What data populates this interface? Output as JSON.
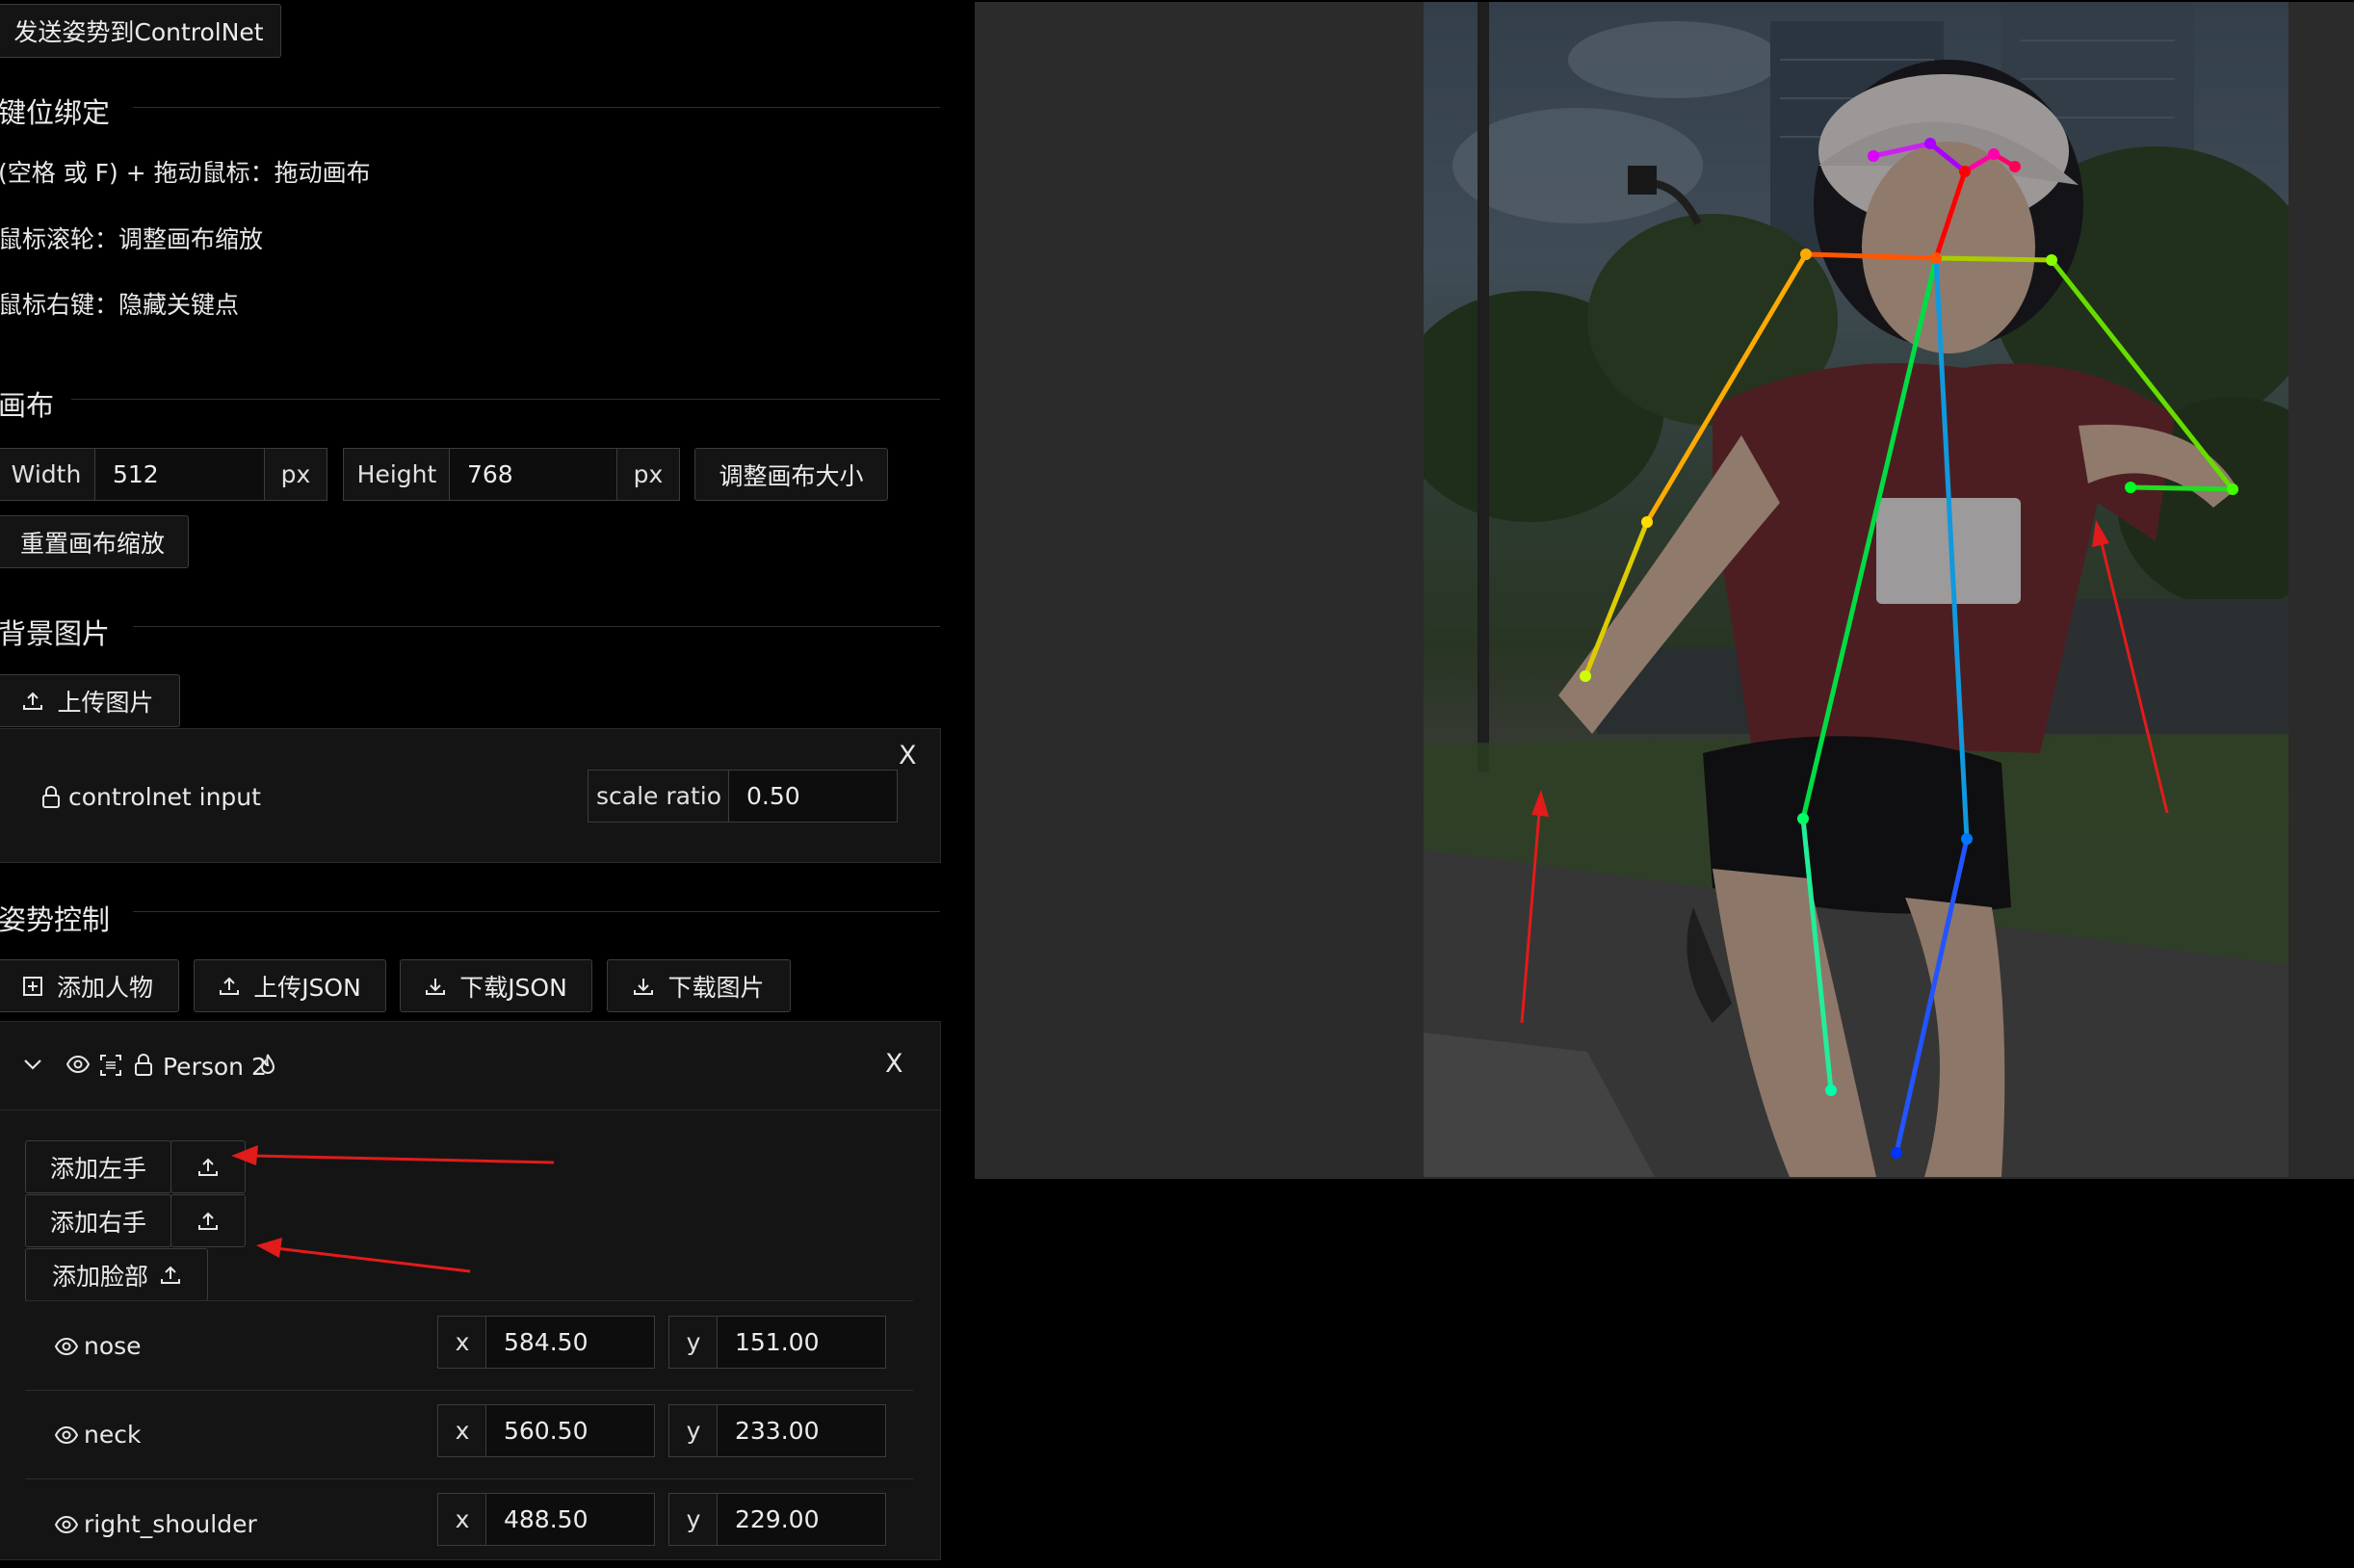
{
  "top": {
    "send_button": "发送姿势到ControlNet"
  },
  "keybinding": {
    "title": "键位绑定",
    "lines": [
      "(空格 或 F) + 拖动鼠标：拖动画布",
      "鼠标滚轮：调整画布缩放",
      "鼠标右键：隐藏关键点"
    ]
  },
  "canvas": {
    "title": "画布",
    "width_label": "Width",
    "width_value": "512",
    "height_label": "Height",
    "height_value": "768",
    "unit": "px",
    "resize_button": "调整画布大小",
    "reset_zoom_button": "重置画布缩放"
  },
  "background": {
    "title": "背景图片",
    "upload_button": "上传图片",
    "card": {
      "label": "controlnet input",
      "scale_label": "scale ratio",
      "scale_value": "0.50",
      "close": "X"
    }
  },
  "pose": {
    "title": "姿势控制",
    "buttons": [
      "添加人物",
      "上传JSON",
      "下载JSON",
      "下载图片"
    ],
    "person": {
      "name": "Person 2",
      "close": "X",
      "add_left_hand": "添加左手",
      "add_right_hand": "添加右手",
      "add_face": "添加脸部",
      "keypoints": [
        {
          "name": "nose",
          "x": "584.50",
          "y": "151.00"
        },
        {
          "name": "neck",
          "x": "560.50",
          "y": "233.00"
        },
        {
          "name": "right_shoulder",
          "x": "488.50",
          "y": "229.00"
        }
      ],
      "x_label": "x",
      "y_label": "y"
    }
  },
  "colors": {
    "background": "#000000",
    "panel": "#141414",
    "border": "#3c3c3c",
    "canvas_bg": "#2b2b2b",
    "annotation_arrow": "#e21b1b"
  }
}
